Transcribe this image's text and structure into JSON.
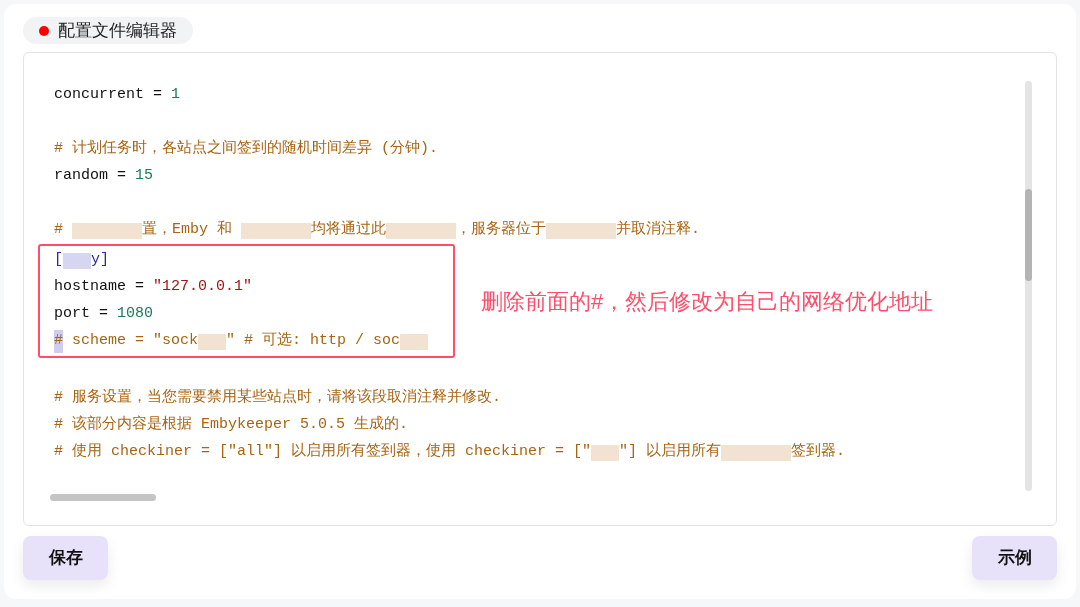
{
  "header": {
    "title": "配置文件编辑器"
  },
  "editor": {
    "blocks": [
      {
        "kind": "lines",
        "lines": [
          {
            "kind": "blank"
          },
          {
            "kind": "code",
            "segments": [
              {
                "kind": "plain",
                "text": "concurrent = "
              },
              {
                "kind": "number",
                "text": "1"
              }
            ]
          },
          {
            "kind": "blank"
          },
          {
            "kind": "code",
            "segments": [
              {
                "kind": "comment",
                "text": "# 计划任务时，各站点之间签到的随机时间差异 (分钟)."
              }
            ]
          },
          {
            "kind": "code",
            "segments": [
              {
                "kind": "plain",
                "text": "random = "
              },
              {
                "kind": "number",
                "text": "15"
              }
            ]
          },
          {
            "kind": "blank"
          },
          {
            "kind": "code",
            "segments": [
              {
                "kind": "comment",
                "text": "# "
              },
              {
                "kind": "redacted",
                "wide": true
              },
              {
                "kind": "comment",
                "text": "置，Emby 和 "
              },
              {
                "kind": "redacted",
                "wide": true
              },
              {
                "kind": "comment",
                "text": "均将通过此"
              },
              {
                "kind": "redacted",
                "wide": true
              },
              {
                "kind": "comment",
                "text": "，服务器位于"
              },
              {
                "kind": "redacted",
                "wide": true
              },
              {
                "kind": "comment",
                "text": "并取消注释."
              }
            ]
          }
        ]
      },
      {
        "kind": "callout",
        "note": "删除前面的#，然后修改为自己的网络优化地址",
        "lines": [
          {
            "kind": "code",
            "segments": [
              {
                "kind": "section",
                "text": "["
              },
              {
                "kind": "redacted",
                "wide": false
              },
              {
                "kind": "section",
                "text": "y]"
              }
            ]
          },
          {
            "kind": "code",
            "segments": [
              {
                "kind": "plain",
                "text": "hostname = "
              },
              {
                "kind": "string",
                "text": "\"127.0.0.1\""
              }
            ]
          },
          {
            "kind": "code",
            "segments": [
              {
                "kind": "plain",
                "text": "port = "
              },
              {
                "kind": "number",
                "text": "1080"
              }
            ]
          },
          {
            "kind": "code",
            "segments": [
              {
                "kind": "selected",
                "text": "#"
              },
              {
                "kind": "comment",
                "text": " scheme = \"sock"
              },
              {
                "kind": "redacted",
                "wide": false
              },
              {
                "kind": "comment",
                "text": "\" # 可选: http / soc"
              },
              {
                "kind": "redacted",
                "wide": false
              }
            ]
          }
        ]
      },
      {
        "kind": "lines",
        "lines": [
          {
            "kind": "blank"
          },
          {
            "kind": "code",
            "segments": [
              {
                "kind": "comment",
                "text": "# 服务设置，当您需要禁用某些站点时，请将该段取消注释并修改."
              }
            ]
          },
          {
            "kind": "code",
            "segments": [
              {
                "kind": "comment",
                "text": "# 该部分内容是根据 Embykeeper 5.0.5 生成的."
              }
            ]
          },
          {
            "kind": "code",
            "segments": [
              {
                "kind": "comment",
                "text": "# 使用 checkiner = [\"all\"] 以启用所有签到器，使用 checkiner = [\""
              },
              {
                "kind": "redacted",
                "wide": false
              },
              {
                "kind": "comment",
                "text": "\"] 以启用所有"
              },
              {
                "kind": "redacted",
                "wide": true
              },
              {
                "kind": "comment",
                "text": "签到器."
              }
            ]
          }
        ]
      }
    ]
  },
  "buttons": [
    {
      "label": "保存"
    },
    {
      "label": "示例"
    }
  ]
}
